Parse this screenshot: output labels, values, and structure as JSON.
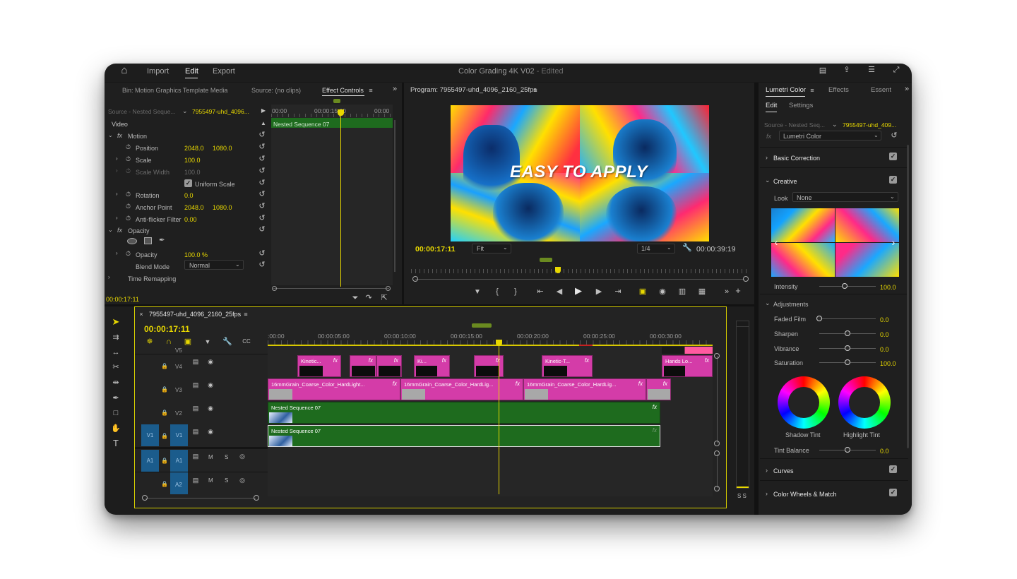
{
  "header": {
    "home": "home-icon",
    "menu": [
      "Import",
      "Edit",
      "Export"
    ],
    "active": "Edit",
    "title": "Color Grading 4K V02",
    "status": "- Edited"
  },
  "left_tabs": [
    "Bin: Motion Graphics Template Media",
    "Source: (no clips)",
    "Effect Controls"
  ],
  "effect_controls": {
    "source": "Source - Nested Seque...",
    "clip": "7955497-uhd_4096...",
    "ruler": [
      "00:00",
      "00:00:15:00",
      "00:00"
    ],
    "sequence_clip": "Nested Sequence 07",
    "video_label": "Video",
    "motion": "Motion",
    "position": {
      "label": "Position",
      "x": "2048.0",
      "y": "1080.0"
    },
    "scale": {
      "label": "Scale",
      "value": "100.0"
    },
    "scale_width": {
      "label": "Scale Width",
      "value": "100.0"
    },
    "uniform": "Uniform Scale",
    "rotation": {
      "label": "Rotation",
      "value": "0.0"
    },
    "anchor": {
      "label": "Anchor Point",
      "x": "2048.0",
      "y": "1080.0"
    },
    "flicker": {
      "label": "Anti-flicker Filter",
      "value": "0.00"
    },
    "opacity_group": "Opacity",
    "opacity": {
      "label": "Opacity",
      "value": "100.0 %"
    },
    "blend": {
      "label": "Blend Mode",
      "value": "Normal"
    },
    "remap": "Time Remapping",
    "timecode": "00:00:17:11"
  },
  "program": {
    "title": "Program: 7955497-uhd_4096_2160_25fps",
    "overlay": "EASY TO APPLY",
    "timecode": "00:00:17:11",
    "fit": "Fit",
    "quality": "1/4",
    "duration": "00:00:39:19"
  },
  "timeline": {
    "tab": "7955497-uhd_4096_2160_25fps",
    "timecode": "00:00:17:11",
    "ruler": [
      ":00:00",
      "00:00:05:00",
      "00:00:10:00",
      "00:00:15:00",
      "00:00:20:00",
      "00:00:25:00",
      "00:00:30:00"
    ],
    "tracks": [
      "V5",
      "V4",
      "V3",
      "V2",
      "V1",
      "A1",
      "A2"
    ],
    "m": "M",
    "s": "S",
    "clips_v4": [
      "Kinetic...",
      "Ki...",
      "Kinetic-T...",
      "Hands Lo..."
    ],
    "clips_v3": [
      "16mmGrain_Coarse_Color_HardLight...",
      "16mmGrain_Coarse_Color_HardLig...",
      "16mmGrain_Coarse_Color_HardLig..."
    ],
    "clip_v2": "Nested Sequence 07",
    "clip_v1": "Nested Sequence 07",
    "fx": "fx",
    "meter": "S S"
  },
  "lumetri": {
    "tabs": [
      "Lumetri Color",
      "Effects",
      "Essent"
    ],
    "subtabs": [
      "Edit",
      "Settings"
    ],
    "source": "Source - Nested Seq...",
    "clip": "7955497-uhd_409...",
    "effect": "Lumetri Color",
    "sections": {
      "basic": "Basic Correction",
      "creative": "Creative",
      "curves": "Curves",
      "wheels": "Color Wheels & Match"
    },
    "look_label": "Look",
    "look": "None",
    "intensity": {
      "label": "Intensity",
      "value": "100.0",
      "frac": 0.45
    },
    "adjustments": "Adjustments",
    "faded": {
      "label": "Faded Film",
      "value": "0.0",
      "frac": 0.0
    },
    "sharpen": {
      "label": "Sharpen",
      "value": "0.0",
      "frac": 0.5
    },
    "vibrance": {
      "label": "Vibrance",
      "value": "0.0",
      "frac": 0.5
    },
    "saturation": {
      "label": "Saturation",
      "value": "100.0",
      "frac": 0.5
    },
    "shadow": "Shadow Tint",
    "highlight": "Highlight Tint",
    "tint": {
      "label": "Tint Balance",
      "value": "0.0",
      "frac": 0.5
    }
  }
}
